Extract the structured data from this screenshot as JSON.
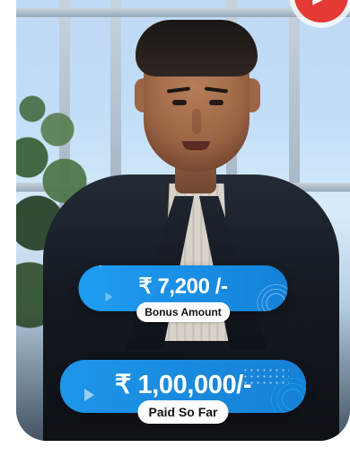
{
  "badge": {
    "icon": "play-icon",
    "symbol": "▶",
    "color": "#e53935"
  },
  "overlay": {
    "bonus_amount_value": "₹ 7,200 /-",
    "bonus_amount_label": "Bonus Amount",
    "paid_value": "₹ 1,00,000/-",
    "paid_label": "Paid So Far",
    "pill_color": "#1f9df2"
  }
}
